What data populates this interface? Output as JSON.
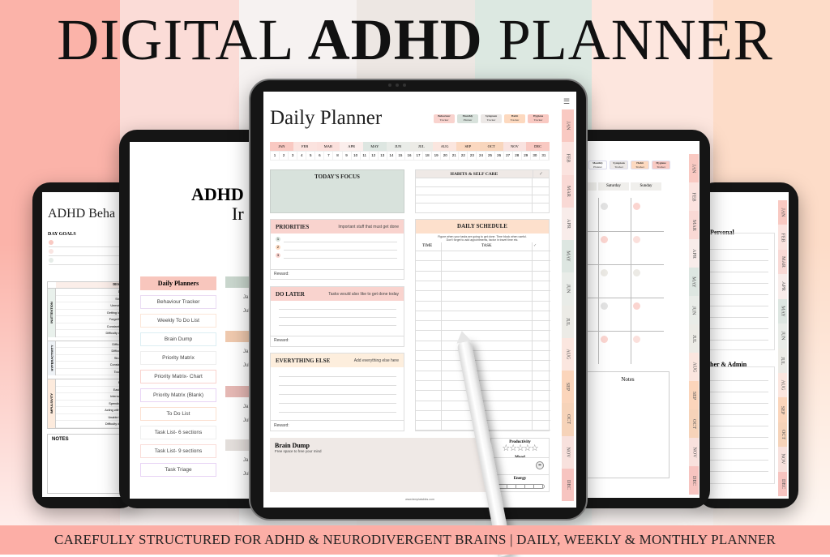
{
  "hero": {
    "title_part1": "DIGITAL ",
    "title_bold": "ADHD",
    "title_part2": " PLANNER"
  },
  "banner": "CAREFULLY STRUCTURED FOR ADHD & NEURODIVERGENT BRAINS | DAILY, WEEKLY & MONTHLY PLANNER",
  "colors": {
    "pink": "#f9c9c2",
    "mint": "#d8e2dc",
    "peach": "#fddcc3",
    "beige": "#efe9e6",
    "banner": "#fcaea6"
  },
  "months": [
    "JAN",
    "FEB",
    "MAR",
    "APR",
    "MAY",
    "JUN",
    "JUL",
    "AUG",
    "SEP",
    "OCT",
    "NOV",
    "DEC"
  ],
  "days": [
    "1",
    "2",
    "3",
    "4",
    "5",
    "6",
    "7",
    "8",
    "9",
    "10",
    "11",
    "12",
    "13",
    "14",
    "15",
    "16",
    "17",
    "18",
    "19",
    "20",
    "21",
    "22",
    "23",
    "24",
    "25",
    "26",
    "27",
    "28",
    "29",
    "30",
    "31"
  ],
  "daily": {
    "title": "Daily Planner",
    "trackers": [
      {
        "l1": "Behaviour",
        "l2": "Tracker"
      },
      {
        "l1": "Monthly",
        "l2": "Planner"
      },
      {
        "l1": "Symptom",
        "l2": "Tracker"
      },
      {
        "l1": "Habit",
        "l2": "Tracker"
      },
      {
        "l1": "Hygiene",
        "l2": "Tracker"
      }
    ],
    "focus": "TODAY'S FOCUS",
    "habits": "HABITS & SELF CARE",
    "check": "✓",
    "priorities": {
      "title": "PRIORITIES",
      "sub": "Important stuff that must get done",
      "nums": [
        "1",
        "2",
        "3"
      ]
    },
    "do_later": {
      "title": "DO LATER",
      "sub": "Tasks would also like to get done today"
    },
    "everything_else": {
      "title": "EVERYTHING ELSE",
      "sub": "Add everything else here"
    },
    "reward": "Reward:",
    "schedule": {
      "title": "DAILY SCHEDULE",
      "sub1": "Figure when your tasks are going to get done. Time block when useful.",
      "sub2": "Don't forget to add appointments, factor in travel time etc.",
      "time": "TIME",
      "task": "TASK"
    },
    "brain_dump": {
      "title": "Brain Dump",
      "sub": "Free space to free your mind"
    },
    "productivity": "Productivity",
    "stars": "☆☆☆☆☆",
    "mood": "Mood",
    "energy": "Energy",
    "footer": "www.templatables.com"
  },
  "index": {
    "title1": "ADHD",
    "title2": "Ir",
    "section": "Daily Planners",
    "items": [
      "Behaviour Tracker",
      "Weekly To Do List",
      "Brain Dump",
      "Priority Matrix",
      "Priority Matrix- Chart",
      "Priority Matrix (Blank)",
      "To Do List",
      "Task List- 6 sections",
      "Task List- 9 sections",
      "Task Triage"
    ],
    "side_labels": [
      "Ja",
      "Jul"
    ]
  },
  "behaviour": {
    "title": "ADHD Beha",
    "day_goals": "DAY GOALS",
    "description": "DESCRIPTION",
    "groups": [
      {
        "name": "INATTENTION",
        "rows": [
          "Distractibility",
          "Short attention",
          "Unmotivated/Slow",
          "Getting lost in details",
          "Forgetful/Confused",
          "Constantly Changing",
          "Difficulty organizing &"
        ]
      },
      {
        "name": "HYPERACTIVITY",
        "rows": [
          "Difficulty relaxing",
          "Difficulty sleeping",
          "Struggling to sit",
          "Constantly moving",
          "Touching things"
        ]
      },
      {
        "name": "IMPULSIVITY",
        "rows": [
          "Binge eating",
          "Easily frustrated",
          "Interrupting others",
          "Spending too much",
          "Acting without thinking",
          "Unable to hold back",
          "Difficulty delaying grat"
        ]
      }
    ],
    "notes": "NOTES"
  },
  "weekly": {
    "trackers": [
      {
        "l1": "Monthly",
        "l2": "Planner"
      },
      {
        "l1": "Symptom",
        "l2": "Tracker"
      },
      {
        "l1": "Habit",
        "l2": "Tracker"
      },
      {
        "l1": "Hygiene",
        "l2": "Tracker"
      }
    ],
    "days": [
      "day",
      "Saturday",
      "Sunday"
    ],
    "notes": "Notes"
  },
  "lists": {
    "personal": "Personal",
    "other": "her & Admin"
  }
}
